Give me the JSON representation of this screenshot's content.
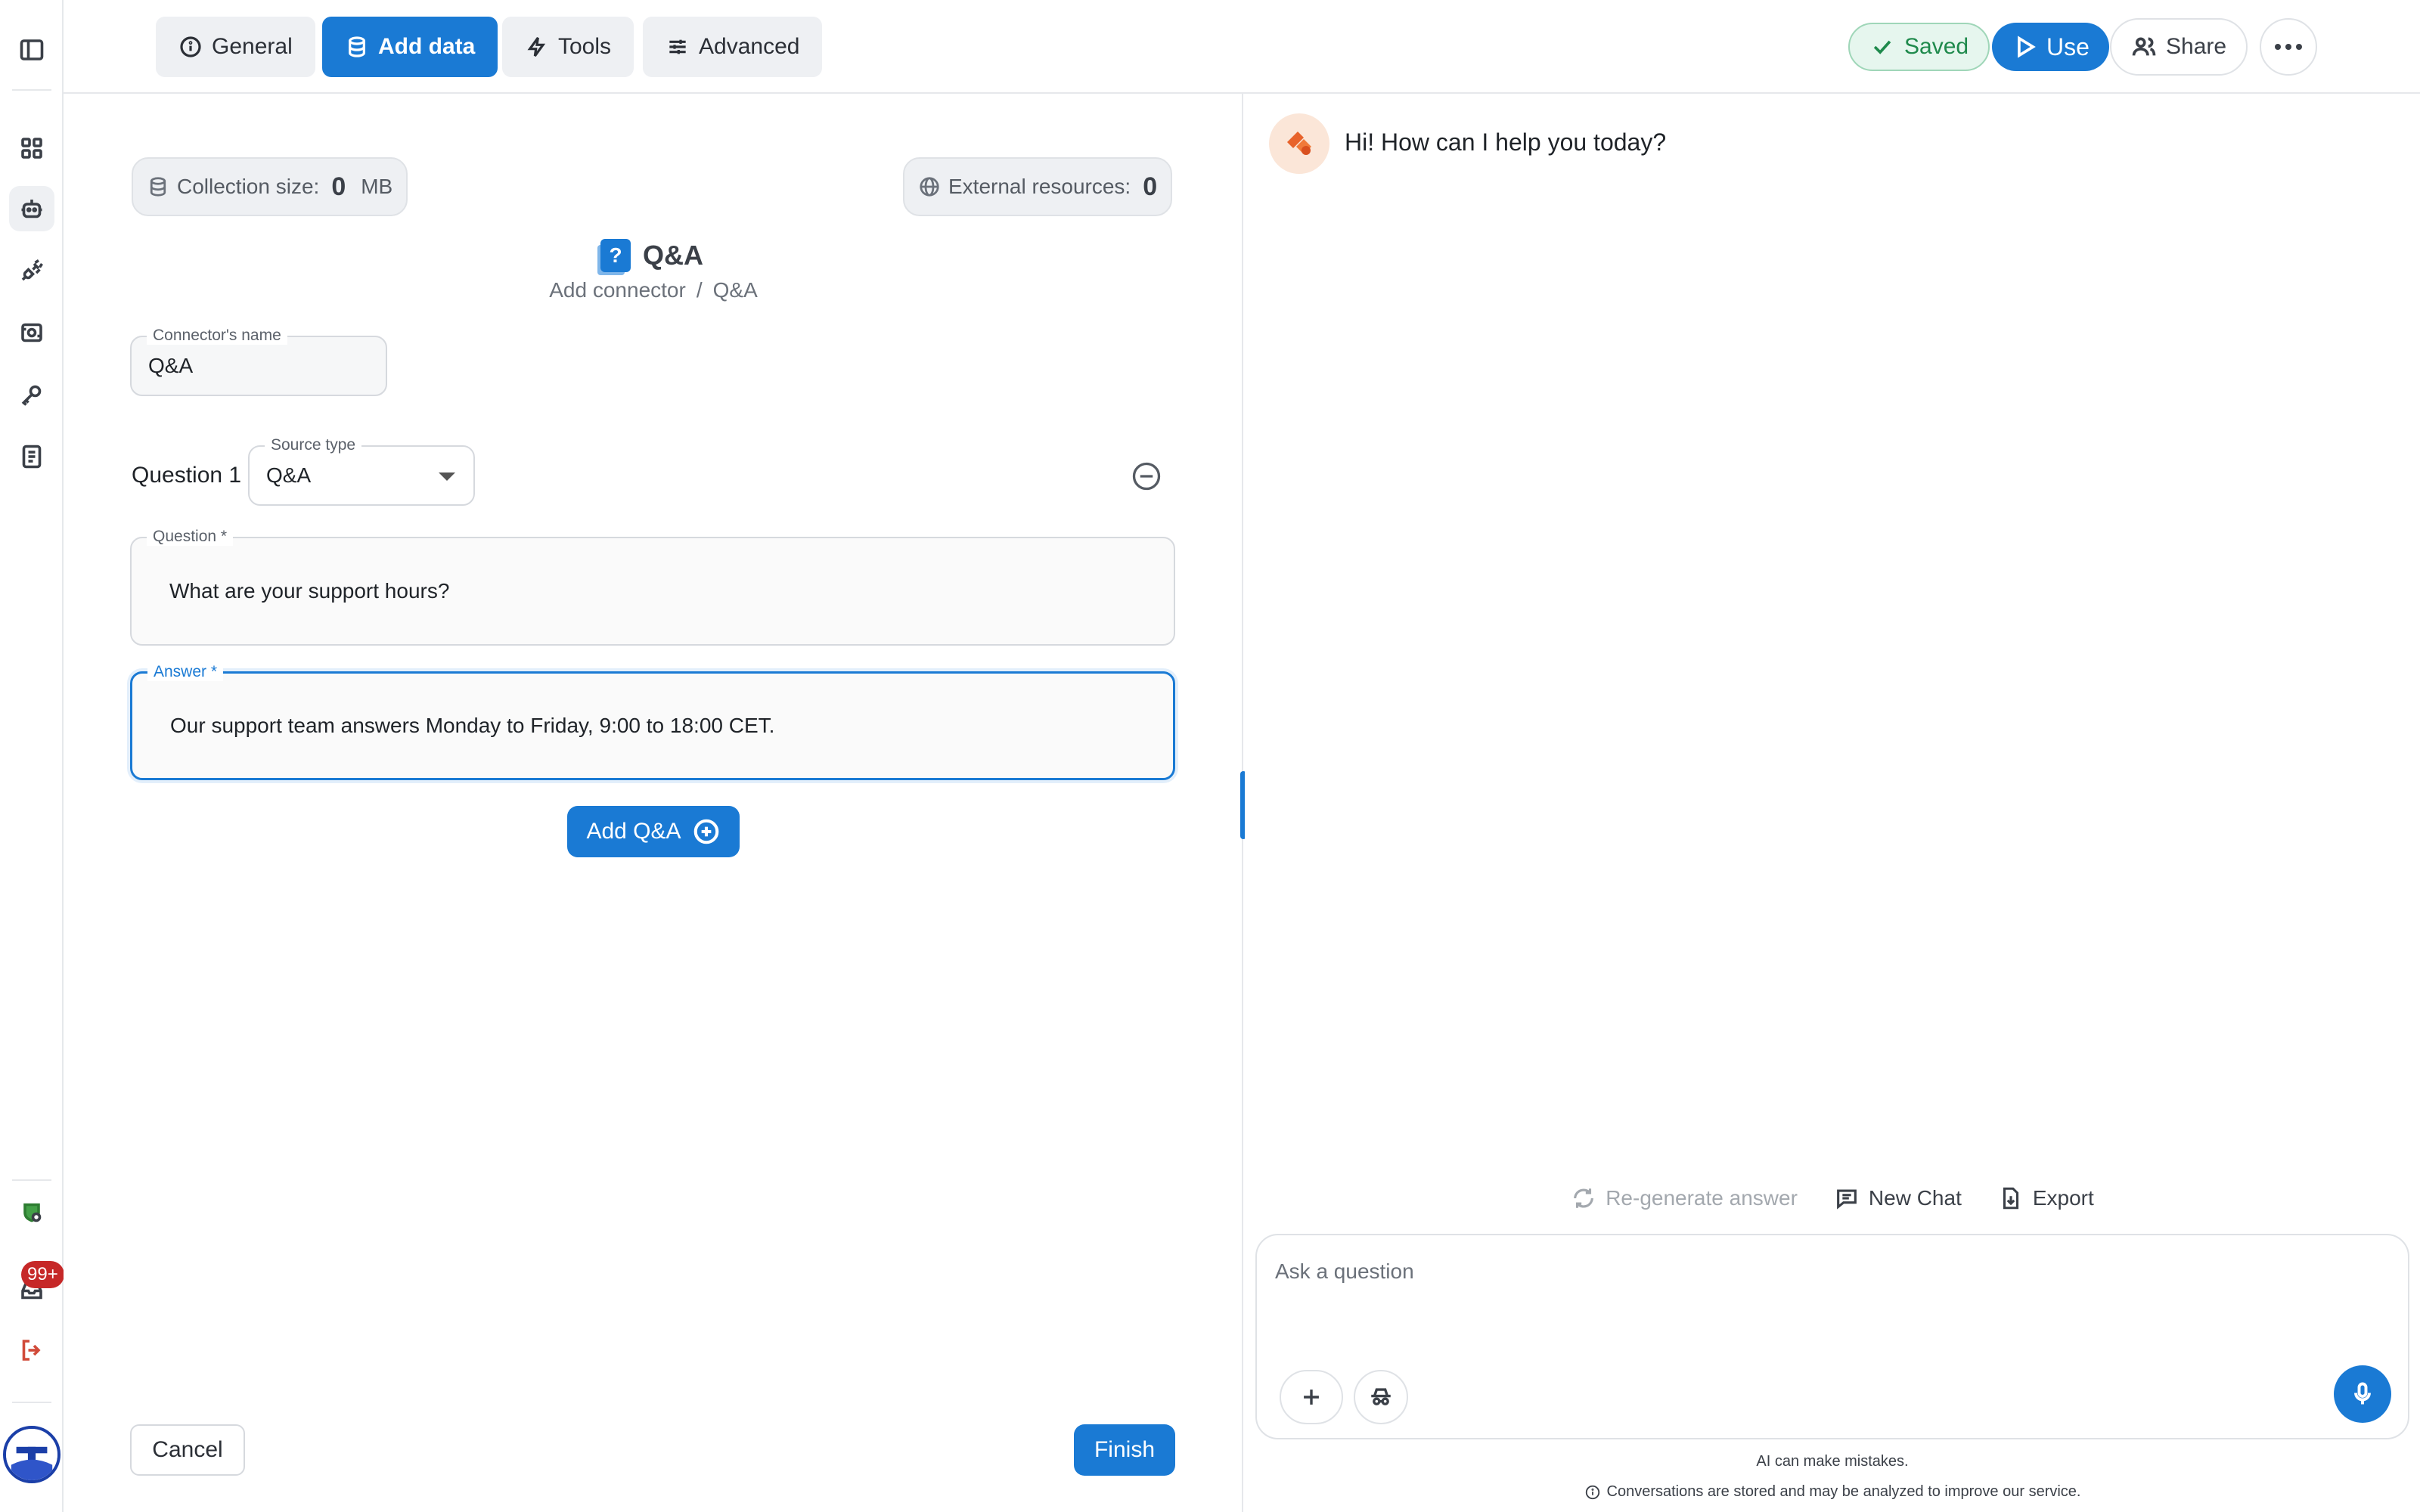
{
  "tabs": [
    {
      "label": "General",
      "icon": "info-icon"
    },
    {
      "label": "Add data",
      "icon": "database-icon",
      "active": true
    },
    {
      "label": "Tools",
      "icon": "bolt-icon"
    },
    {
      "label": "Advanced",
      "icon": "sliders-icon"
    }
  ],
  "header": {
    "saved_label": "Saved",
    "use_label": "Use",
    "share_label": "Share"
  },
  "rail": {
    "notification_count": "99+"
  },
  "editor": {
    "collection_label": "Collection size:",
    "collection_value": "0",
    "collection_unit": "MB",
    "external_label": "External resources:",
    "external_value": "0",
    "connector_title": "Q&A",
    "breadcrumb": [
      "Add connector",
      "Q&A"
    ],
    "connector_name_label": "Connector's name",
    "connector_name_value": "Q&A",
    "question_index_label": "Question 1",
    "source_type_label": "Source type",
    "source_type_value": "Q&A",
    "question_label": "Question *",
    "question_value": "What are your support hours?",
    "answer_label": "Answer *",
    "answer_value": "Our support team answers Monday to Friday, 9:00 to 18:00 CET.",
    "add_qa_label": "Add Q&A",
    "cancel_label": "Cancel",
    "finish_label": "Finish"
  },
  "chat": {
    "greeting": "Hi! How can I help you today?",
    "regenerate_label": "Re-generate answer",
    "new_chat_label": "New Chat",
    "export_label": "Export",
    "input_placeholder": "Ask a question",
    "disclaimer_1": "AI can make mistakes.",
    "disclaimer_2": "Conversations are stored and may be analyzed to improve our service."
  },
  "colors": {
    "accent": "#1a7ad4",
    "saved_green": "#1f8a4c",
    "badge_red": "#c62828"
  }
}
